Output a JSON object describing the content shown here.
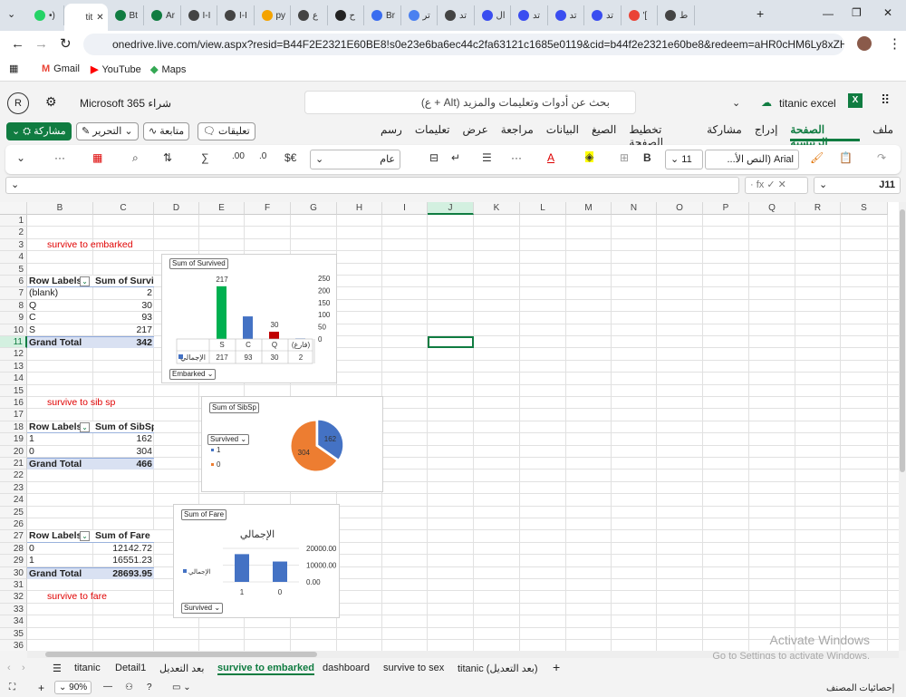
{
  "browser": {
    "tabs": [
      {
        "label": "•)",
        "color": "#25d366"
      },
      {
        "label": "tit",
        "color": "#fff",
        "active": true
      },
      {
        "label": "Bt",
        "color": "#107c41"
      },
      {
        "label": "Ar",
        "color": "#107c41"
      },
      {
        "label": "I-I",
        "color": "#444"
      },
      {
        "label": "I-I",
        "color": "#444"
      },
      {
        "label": "py",
        "color": "#f4a300"
      },
      {
        "label": "ع",
        "color": "#444"
      },
      {
        "label": "ح",
        "color": "#222"
      },
      {
        "label": "Br",
        "color": "#3a6df0"
      },
      {
        "label": "تر",
        "color": "#4a80f0"
      },
      {
        "label": "تد",
        "color": "#444"
      },
      {
        "label": "ال",
        "color": "#3a4df0"
      },
      {
        "label": "تد",
        "color": "#3a4df0"
      },
      {
        "label": "تد",
        "color": "#3a4df0"
      },
      {
        "label": "تد",
        "color": "#3a4df0"
      },
      {
        "label": "'[",
        "color": "#ea4335"
      },
      {
        "label": "ط",
        "color": "#444"
      }
    ],
    "url": "onedrive.live.com/view.aspx?resid=B44F2E2321E60BE8!s0e23e6ba6ec44c2fa63121c1685e0119&cid=b44f2e2321e60be8&redeem=aHR0cHM6Ly8xZHJ2Lm1zL2...",
    "bookmarks": [
      "Gmail",
      "YouTube",
      "Maps"
    ]
  },
  "app": {
    "user_initial": "R",
    "buy_label": "Microsoft 365 شراء",
    "search_placeholder": "بحث عن أدوات وتعليمات والمزيد (Alt + ع)",
    "file_name": "titanic excel",
    "menu": [
      "ملف",
      "الصفحة الرئيسية",
      "إدراج",
      "مشاركة",
      "تخطيط الصفحة",
      "الصيغ",
      "البيانات",
      "مراجعة",
      "عرض",
      "تعليمات",
      "رسم"
    ],
    "active_menu": "الصفحة الرئيسية",
    "share_label": "مشاركة",
    "edit_label": "التحرير",
    "follow_label": "متابعة",
    "comments_label": "تعليقات"
  },
  "ribbon": {
    "font": "Arial (النص الأ...",
    "size": "11",
    "number_format": "عام",
    "bold": "B",
    "currency": "$€",
    "more": "···",
    "sum": "∑"
  },
  "formula_bar": {
    "name_box": "J11",
    "value": ""
  },
  "columns": [
    "B",
    "C",
    "D",
    "E",
    "F",
    "G",
    "H",
    "I",
    "J",
    "K",
    "L",
    "M",
    "N",
    "O",
    "P",
    "Q",
    "R",
    "S"
  ],
  "selected_column": "J",
  "selected_row": 11,
  "cells": [
    {
      "r": 3,
      "c": "B",
      "text": "survive to embarked",
      "cls": "red"
    },
    {
      "r": 6,
      "c": "B",
      "text": "Row Labels",
      "cls": "hdr"
    },
    {
      "r": 6,
      "c": "C",
      "text": "Sum of Survived",
      "cls": "hdr"
    },
    {
      "r": 7,
      "c": "B",
      "text": "(blank)"
    },
    {
      "r": 7,
      "c": "C",
      "text": "2",
      "cls": "right"
    },
    {
      "r": 8,
      "c": "B",
      "text": "Q"
    },
    {
      "r": 8,
      "c": "C",
      "text": "30",
      "cls": "right"
    },
    {
      "r": 9,
      "c": "B",
      "text": "C"
    },
    {
      "r": 9,
      "c": "C",
      "text": "93",
      "cls": "right"
    },
    {
      "r": 10,
      "c": "B",
      "text": "S"
    },
    {
      "r": 10,
      "c": "C",
      "text": "217",
      "cls": "right"
    },
    {
      "r": 11,
      "c": "B",
      "text": "Grand Total",
      "cls": "tot"
    },
    {
      "r": 11,
      "c": "C",
      "text": "342",
      "cls": "tot right"
    },
    {
      "r": 16,
      "c": "B",
      "text": "survive to sib sp",
      "cls": "red"
    },
    {
      "r": 18,
      "c": "B",
      "text": "Row Labels",
      "cls": "hdr"
    },
    {
      "r": 18,
      "c": "C",
      "text": "Sum of SibSp",
      "cls": "hdr"
    },
    {
      "r": 19,
      "c": "B",
      "text": "1"
    },
    {
      "r": 19,
      "c": "C",
      "text": "162",
      "cls": "right"
    },
    {
      "r": 20,
      "c": "B",
      "text": "0"
    },
    {
      "r": 20,
      "c": "C",
      "text": "304",
      "cls": "right"
    },
    {
      "r": 21,
      "c": "B",
      "text": "Grand Total",
      "cls": "tot"
    },
    {
      "r": 21,
      "c": "C",
      "text": "466",
      "cls": "tot right"
    },
    {
      "r": 27,
      "c": "B",
      "text": "Row Labels",
      "cls": "hdr"
    },
    {
      "r": 27,
      "c": "C",
      "text": "Sum of Fare",
      "cls": "hdr"
    },
    {
      "r": 28,
      "c": "B",
      "text": "0"
    },
    {
      "r": 28,
      "c": "C",
      "text": "12142.72",
      "cls": "right"
    },
    {
      "r": 29,
      "c": "B",
      "text": "1"
    },
    {
      "r": 29,
      "c": "C",
      "text": "16551.23",
      "cls": "right"
    },
    {
      "r": 30,
      "c": "B",
      "text": "Grand Total",
      "cls": "tot"
    },
    {
      "r": 30,
      "c": "C",
      "text": "28693.95",
      "cls": "tot right"
    },
    {
      "r": 32,
      "c": "B",
      "text": "survive to fare",
      "cls": "red"
    }
  ],
  "chart_data": [
    {
      "type": "bar",
      "field_button": "Sum of Survived",
      "axis_field": "Embarked",
      "categories": [
        "S",
        "C",
        "Q",
        "(فارغ)"
      ],
      "values": [
        217,
        93,
        30,
        2
      ],
      "colors": [
        "#00b050",
        "#4472c4",
        "#c00000",
        "#4472c4"
      ],
      "data_labels": {
        "S": "217",
        "Q": "30"
      },
      "yticks": [
        0,
        50,
        100,
        150,
        200,
        250
      ],
      "ylim": [
        0,
        250
      ],
      "series": [
        {
          "name": "الإجمالي"
        }
      ]
    },
    {
      "type": "pie",
      "field_button": "Sum of SibSp",
      "axis_field": "Survived",
      "categories": [
        "1",
        "0"
      ],
      "values": [
        162,
        304
      ],
      "colors": [
        "#4472c4",
        "#ed7d31"
      ]
    },
    {
      "type": "bar",
      "field_button": "Sum of Fare",
      "axis_field": "Survived",
      "title": "الإجمالي",
      "categories": [
        "1",
        "0"
      ],
      "values": [
        16551.23,
        12142.72
      ],
      "colors": [
        "#4472c4",
        "#4472c4"
      ],
      "yticks": [
        "0.00",
        "10000.00",
        "20000.00"
      ],
      "ylim": [
        0,
        20000
      ],
      "series": [
        {
          "name": "الإجمالي"
        }
      ]
    }
  ],
  "sheets": [
    "titanic",
    "Detail1",
    "بعد التعديل",
    "survive to embarked",
    "dashboard",
    "survive to sex",
    "titanic (بعد التعديل)"
  ],
  "active_sheet": "survive to embarked",
  "status": {
    "zoom": "90%",
    "workbook_stats": "إحصائيات المصنف"
  },
  "watermark": {
    "line1": "Activate Windows",
    "line2": "Go to Settings to activate Windows."
  }
}
